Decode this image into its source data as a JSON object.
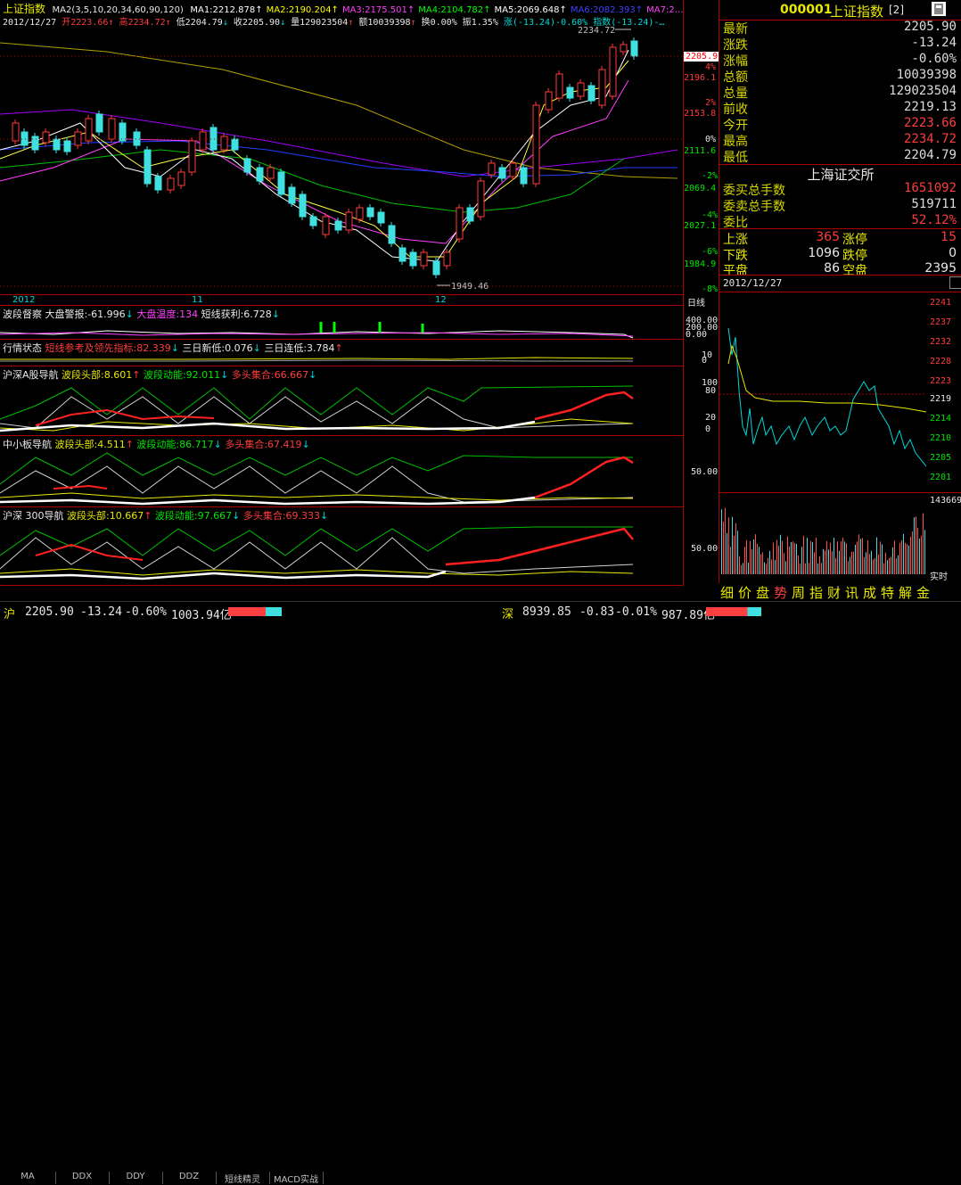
{
  "kchart": {
    "name": "上证指数",
    "ma_hdr": "MA2(3,5,10,20,34,60,90,120)",
    "ma": [
      {
        "label": "MA1:2212.878",
        "color": "#ffffff"
      },
      {
        "label": "MA2:2190.204",
        "color": "#ffff00"
      },
      {
        "label": "MA3:2175.501",
        "color": "#ff40ff"
      },
      {
        "label": "MA4:2104.782",
        "color": "#00ff00"
      },
      {
        "label": "MA5:2069.648",
        "color": "#ffffff"
      },
      {
        "label": "MA6:2082.393",
        "color": "#4040ff"
      },
      {
        "label": "MA7:2…",
        "color": "#ff40ff"
      }
    ],
    "date": "2012/12/27",
    "open": "开2223.66",
    "high": "高2234.72",
    "low": "低2204.79",
    "close": "收2205.90",
    "vol": "量129023504",
    "amt": "额10039398",
    "turn": "换0.00%",
    "amp": "振1.35%",
    "chg": "涨(-13.24)-0.60%",
    "idx": "指数(-13.24)-…",
    "hi_mark": "2234.72",
    "lo_mark": "1949.46",
    "cur": "2205.9",
    "months": [
      "2012",
      "11",
      "12"
    ],
    "axis_prices": [
      "2196.1",
      "2153.8",
      "2111.6",
      "2069.4",
      "2027.1",
      "1984.9"
    ],
    "axis_pct": [
      "4%",
      "2%",
      "0%",
      "-2%",
      "-4%",
      "-6%",
      "-8%"
    ],
    "day_label": "日线"
  },
  "pane1": {
    "name": "波段督察",
    "t1": "大盘警报:-61.996",
    "t2": "大盘温度:134",
    "t3": "短线获利:6.728",
    "ax": [
      "400.00",
      "200.00",
      "0.00"
    ]
  },
  "pane2": {
    "name": "行情状态",
    "t1": "短线参考及领先指标:82.339",
    "t2": "三日新低:0.076",
    "t3": "三日连低:3.784",
    "ax": [
      "10",
      "0"
    ]
  },
  "pane3": {
    "name": "沪深A股导航",
    "t1": "波段头部:8.601",
    "t2": "波段动能:92.011",
    "t3": "多头集合:66.667",
    "ax": [
      "100",
      "80",
      "20",
      "0"
    ]
  },
  "pane4": {
    "name": "中小板导航",
    "t1": "波段头部:4.511",
    "t2": "波段动能:86.717",
    "t3": "多头集合:67.419",
    "ax": [
      "50.00"
    ]
  },
  "pane5": {
    "name": "沪深 300导航",
    "t1": "波段头部:10.667",
    "t2": "波段动能:97.667",
    "t3": "多头集合:69.333",
    "ax": [
      "50.00"
    ]
  },
  "tabs": [
    "MA",
    "DDX",
    "DDY",
    "DDZ",
    "短线精灵",
    "MACD实战"
  ],
  "quote": {
    "code": "000001",
    "name": "上证指数",
    "badge": "[2]",
    "rows": [
      {
        "k": "最新",
        "v": "2205.90",
        "c": "wht"
      },
      {
        "k": "涨跌",
        "v": "-13.24",
        "c": "wht"
      },
      {
        "k": "涨幅",
        "v": "-0.60%",
        "c": "wht"
      },
      {
        "k": "总额",
        "v": "10039398",
        "c": "wht"
      },
      {
        "k": "总量",
        "v": "129023504",
        "c": "wht"
      },
      {
        "k": "前收",
        "v": "2219.13",
        "c": "wht"
      },
      {
        "k": "今开",
        "v": "2223.66",
        "c": "red"
      },
      {
        "k": "最高",
        "v": "2234.72",
        "c": "red"
      },
      {
        "k": "最低",
        "v": "2204.79",
        "c": "wht"
      }
    ],
    "exchange": "上海证交所",
    "rows2": [
      {
        "k": "委买总手数",
        "v": "1651092",
        "c": "red"
      },
      {
        "k": "委卖总手数",
        "v": "519711",
        "c": "wht"
      },
      {
        "k": "委比",
        "v": "52.12%",
        "c": "red"
      }
    ],
    "up_k": "上涨",
    "up_v": "365",
    "lim_up_k": "涨停",
    "lim_up_v": "15",
    "down_k": "下跌",
    "down_v": "1096",
    "lim_dn_k": "跌停",
    "lim_dn_v": "0",
    "flat_k": "平盘",
    "flat_v": "86",
    "empty_k": "空盘",
    "empty_v": "2395"
  },
  "intraday": {
    "date": "2012/12/27",
    "prices": [
      "2241",
      "2237",
      "2232",
      "2228",
      "2223",
      "2219",
      "2214",
      "2210",
      "2205",
      "2201"
    ],
    "vol_top": "143669",
    "realtime": "实时",
    "bottom_tabs": [
      "细",
      "价",
      "盘",
      "势",
      "周",
      "指",
      "财",
      "讯",
      "成",
      "特",
      "解",
      "金"
    ]
  },
  "status": {
    "sh_label": "沪",
    "sh_price": "2205.90",
    "sh_chg": "-13.24",
    "sh_pct": "-0.60%",
    "sh_amt": "1003.94亿",
    "sz_label": "深",
    "sz_price": "8939.85",
    "sz_chg": "-0.83",
    "sz_pct": "-0.01%",
    "sz_amt": "987.89亿"
  }
}
